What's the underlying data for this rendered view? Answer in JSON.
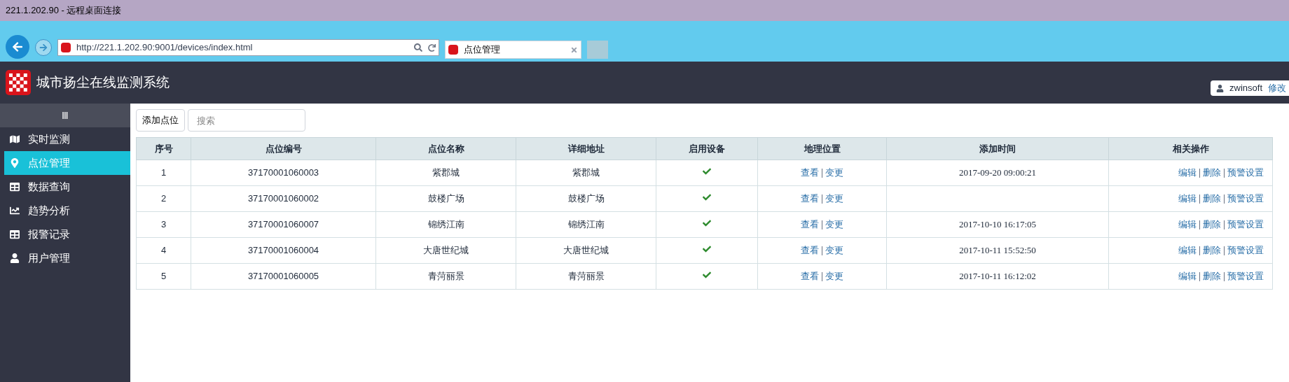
{
  "window": {
    "title": "221.1.202.90 - 远程桌面连接"
  },
  "browser": {
    "url": "http://221.1.202.90:9001/devices/index.html",
    "tab": "点位管理"
  },
  "header": {
    "title": "城市扬尘在线监测系统",
    "user": "zwinsoft",
    "edit_link": "修改"
  },
  "sidebar": {
    "toggle": "Ⅲ",
    "items": [
      {
        "label": "实时监测",
        "selected": false
      },
      {
        "label": "点位管理",
        "selected": true
      },
      {
        "label": "数据查询",
        "selected": false
      },
      {
        "label": "趋势分析",
        "selected": false
      },
      {
        "label": "报警记录",
        "selected": false
      },
      {
        "label": "用户管理",
        "selected": false
      }
    ]
  },
  "toolbar": {
    "add_button": "添加点位",
    "search": {
      "placeholder": "搜索"
    }
  },
  "table": {
    "columns": [
      "序号",
      "点位编号",
      "点位名称",
      "详细地址",
      "启用设备",
      "地理位置",
      "添加时间",
      "相关操作"
    ],
    "rows": [
      {
        "no": "1",
        "code": "37170001060003",
        "name": "紫郡城",
        "address": "紫郡城",
        "enabled": true,
        "geo": [
          "查看",
          "变更"
        ],
        "time": "2017-09-20 09:00:21",
        "actions": [
          "编辑",
          "删除",
          "预警设置"
        ]
      },
      {
        "no": "2",
        "code": "37170001060002",
        "name": "鼓楼广场",
        "address": "鼓楼广场",
        "enabled": true,
        "geo": [
          "查看",
          "变更"
        ],
        "actions": [
          "编辑",
          "删除",
          "预警设置"
        ]
      },
      {
        "no": "3",
        "code": "37170001060007",
        "name": "锦绣江南",
        "address": "锦绣江南",
        "enabled": true,
        "geo": [
          "查看",
          "变更"
        ],
        "time": "2017-10-10 16:17:05",
        "actions": [
          "编辑",
          "删除",
          "预警设置"
        ]
      },
      {
        "no": "4",
        "code": "37170001060004",
        "name": "大唐世纪城",
        "address": "大唐世纪城",
        "enabled": true,
        "geo": [
          "查看",
          "变更"
        ],
        "time": "2017-10-11 15:52:50",
        "actions": [
          "编辑",
          "删除",
          "预警设置"
        ]
      },
      {
        "no": "5",
        "code": "37170001060005",
        "name": "青菏丽景",
        "address": "青菏丽景",
        "enabled": true,
        "geo": [
          "查看",
          "变更"
        ],
        "time": "2017-10-11 16:12:02",
        "actions": [
          "编辑",
          "删除",
          "预警设置"
        ]
      }
    ]
  }
}
